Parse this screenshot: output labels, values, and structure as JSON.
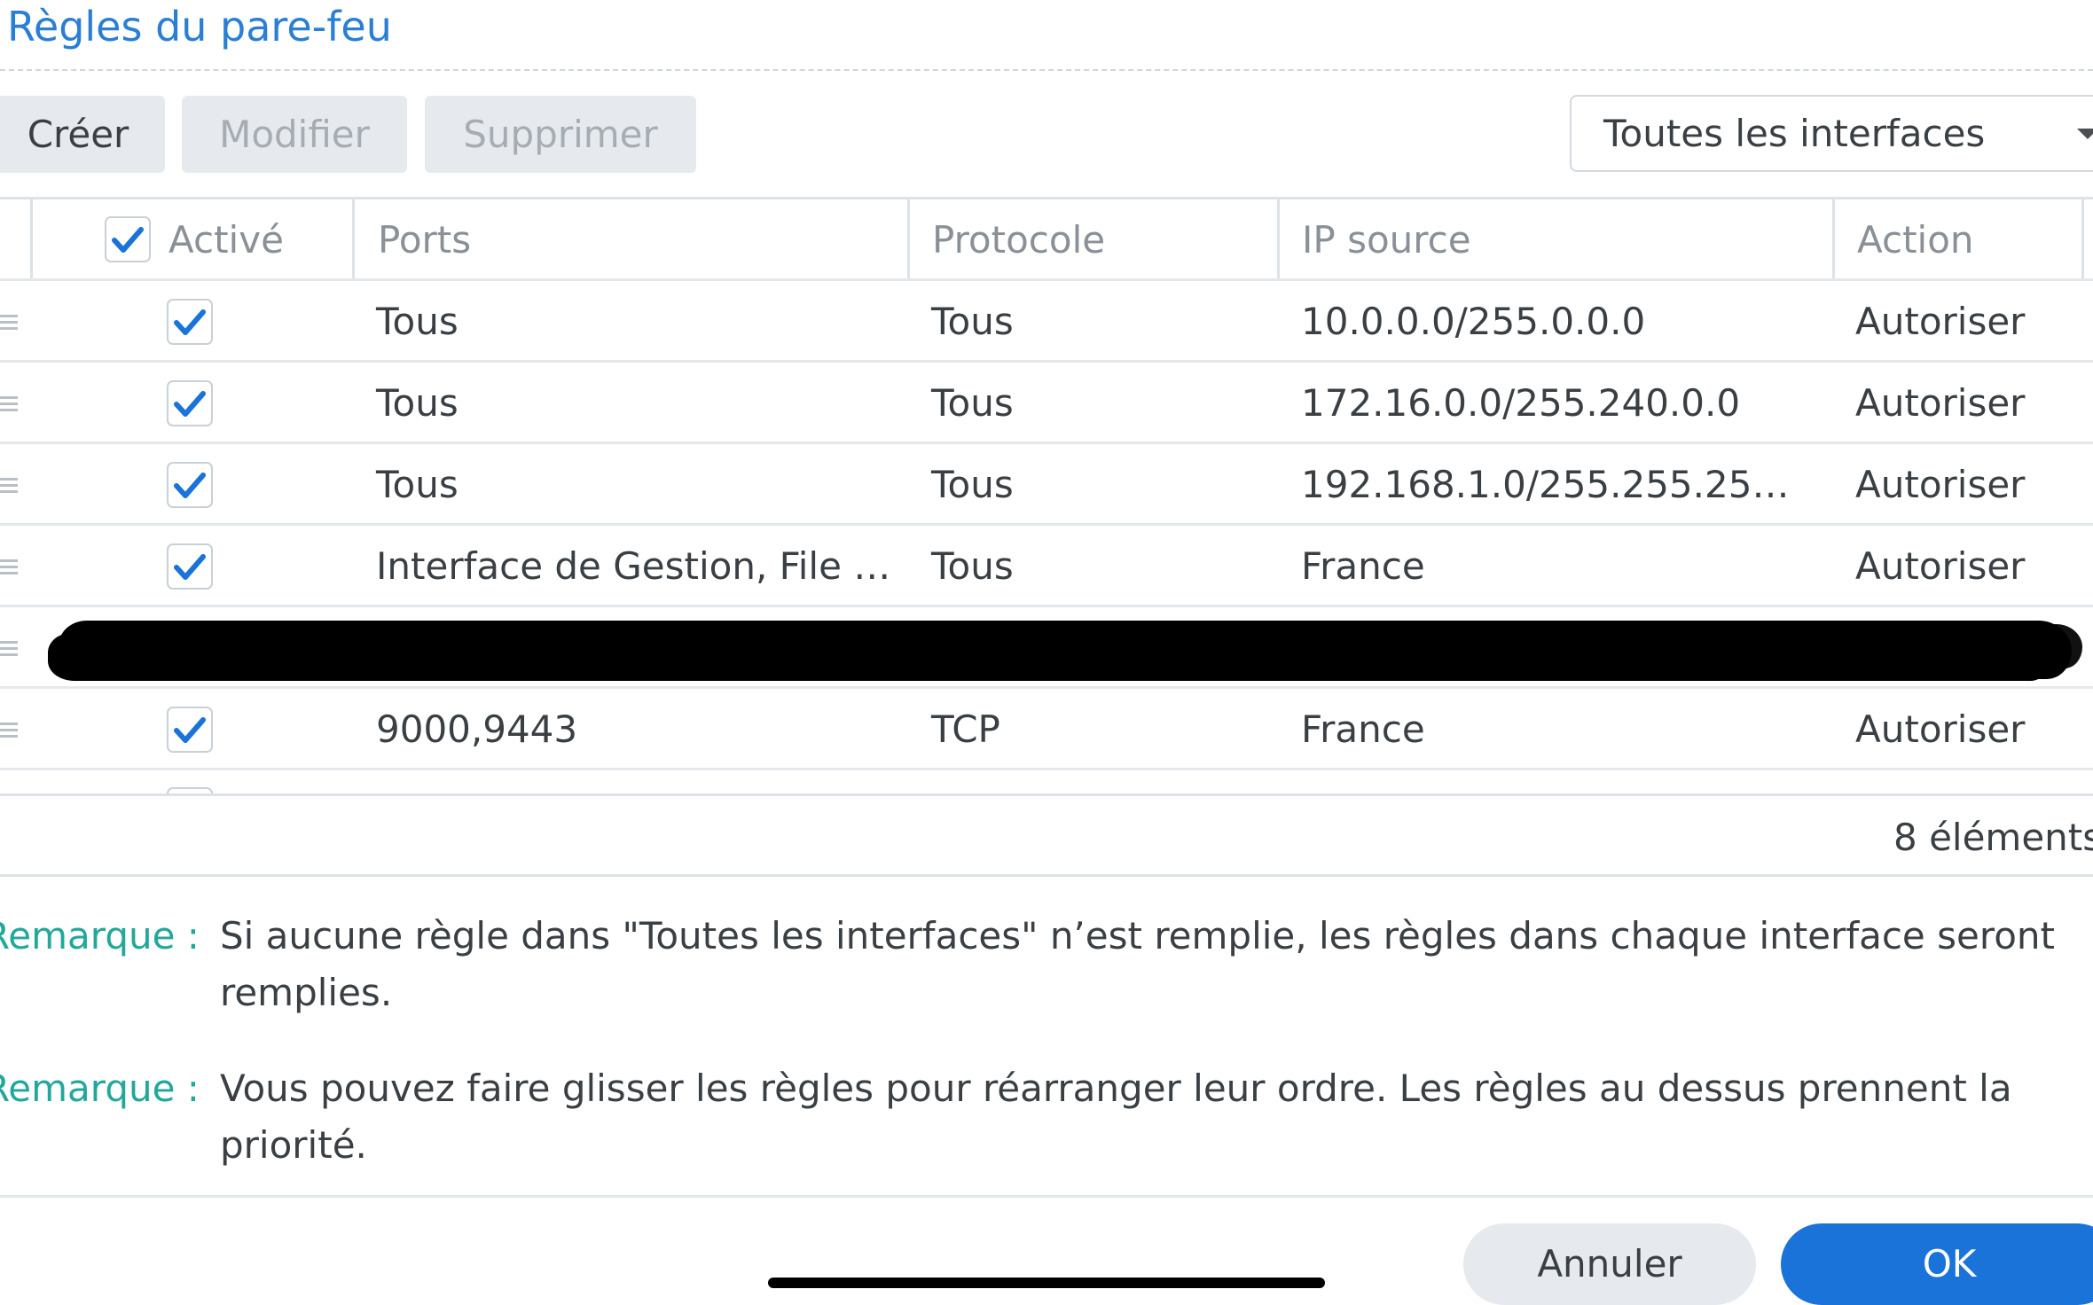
{
  "dialog": {
    "title": "Règles du pare-feu"
  },
  "toolbar": {
    "create_label": "Créer",
    "modify_label": "Modifier",
    "delete_label": "Supprimer",
    "interface_select": "Toutes les interfaces"
  },
  "table": {
    "headers": {
      "enabled": "Activé",
      "ports": "Ports",
      "protocol": "Protocole",
      "source_ip": "IP source",
      "action": "Action"
    },
    "select_all_checked": true,
    "rows": [
      {
        "enabled": true,
        "ports": "Tous",
        "protocol": "Tous",
        "source_ip": "10.0.0.0/255.0.0.0",
        "action": "Autoriser",
        "redacted": false
      },
      {
        "enabled": true,
        "ports": "Tous",
        "protocol": "Tous",
        "source_ip": "172.16.0.0/255.240.0.0",
        "action": "Autoriser",
        "redacted": false
      },
      {
        "enabled": true,
        "ports": "Tous",
        "protocol": "Tous",
        "source_ip": "192.168.1.0/255.255.25…",
        "action": "Autoriser",
        "redacted": false
      },
      {
        "enabled": true,
        "ports": "Interface de Gestion, File …",
        "protocol": "Tous",
        "source_ip": "France",
        "action": "Autoriser",
        "redacted": false
      },
      {
        "enabled": null,
        "ports": "",
        "protocol": "",
        "source_ip": "",
        "action": "",
        "redacted": true
      },
      {
        "enabled": true,
        "ports": "9000,9443",
        "protocol": "TCP",
        "source_ip": "France",
        "action": "Autoriser",
        "redacted": false
      }
    ],
    "item_count": "8 éléments"
  },
  "notes": [
    {
      "label": "Remarque :",
      "text": "Si aucune règle dans \"Toutes les interfaces\" n’est remplie, les règles dans chaque interface seront remplies."
    },
    {
      "label": "Remarque :",
      "text": "Vous pouvez faire glisser les règles pour réarranger leur ordre. Les règles au dessus prennent la priorité."
    }
  ],
  "footer": {
    "cancel_label": "Annuler",
    "ok_label": "OK"
  },
  "colors": {
    "title": "#2a7fd4",
    "note_label": "#22a89a",
    "ok_button": "#1a73d9",
    "checkmark": "#1a73d9"
  }
}
